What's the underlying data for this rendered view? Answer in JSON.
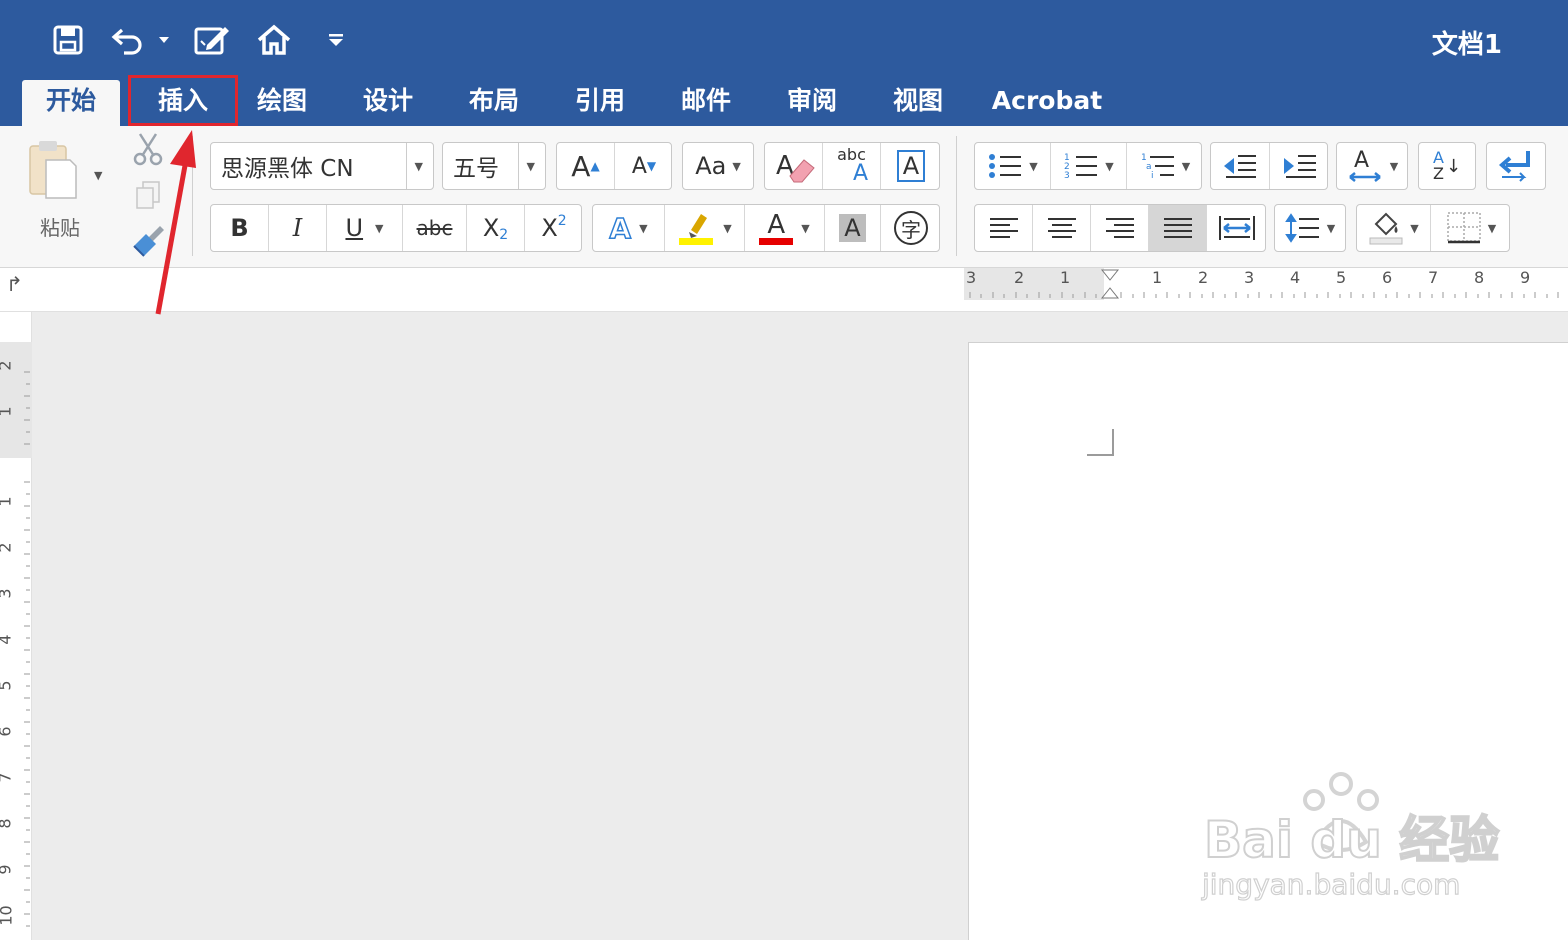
{
  "window": {
    "title": "文档1"
  },
  "quick_access": {
    "icons": [
      "save-icon",
      "undo-icon",
      "edit-document-icon",
      "home-icon",
      "customize-menu-icon"
    ]
  },
  "tabs": [
    {
      "label": "开始",
      "active": true
    },
    {
      "label": "插入",
      "active": false,
      "highlighted": true
    },
    {
      "label": "绘图",
      "active": false
    },
    {
      "label": "设计",
      "active": false
    },
    {
      "label": "布局",
      "active": false
    },
    {
      "label": "引用",
      "active": false
    },
    {
      "label": "邮件",
      "active": false
    },
    {
      "label": "审阅",
      "active": false
    },
    {
      "label": "视图",
      "active": false
    },
    {
      "label": "Acrobat",
      "active": false
    }
  ],
  "ribbon": {
    "paste_label": "粘贴",
    "font_name": "思源黑体 CN",
    "font_size": "五号",
    "grow_font": "A",
    "shrink_font": "A",
    "change_case": "Aa",
    "clear_formatting": "A",
    "phonetic_top": "abc",
    "phonetic_bottom": "A",
    "char_border": "A",
    "bold": "B",
    "italic": "I",
    "underline": "U",
    "strikethrough": "abc",
    "subscript_base": "X",
    "subscript_sub": "2",
    "superscript_base": "X",
    "superscript_sup": "2",
    "text_effects": "A",
    "font_color": "A",
    "char_shading": "A",
    "enclose_char": "字",
    "sort_top": "A",
    "sort_bottom": "Z"
  },
  "colors": {
    "titlebar": "#2d5a9e",
    "highlight": "#fff200",
    "font_color": "#e60000",
    "annotation": "#e0262e"
  },
  "ruler": {
    "horizontal": [
      "3",
      "2",
      "1",
      "1",
      "2",
      "3",
      "4",
      "5",
      "6",
      "7",
      "8",
      "9"
    ],
    "vertical": [
      "2",
      "1",
      "1",
      "2",
      "3",
      "4",
      "5",
      "6",
      "7",
      "8",
      "9",
      "10"
    ]
  },
  "watermark": {
    "brand": "Bai du 经验",
    "url": "jingyan.baidu.com"
  }
}
